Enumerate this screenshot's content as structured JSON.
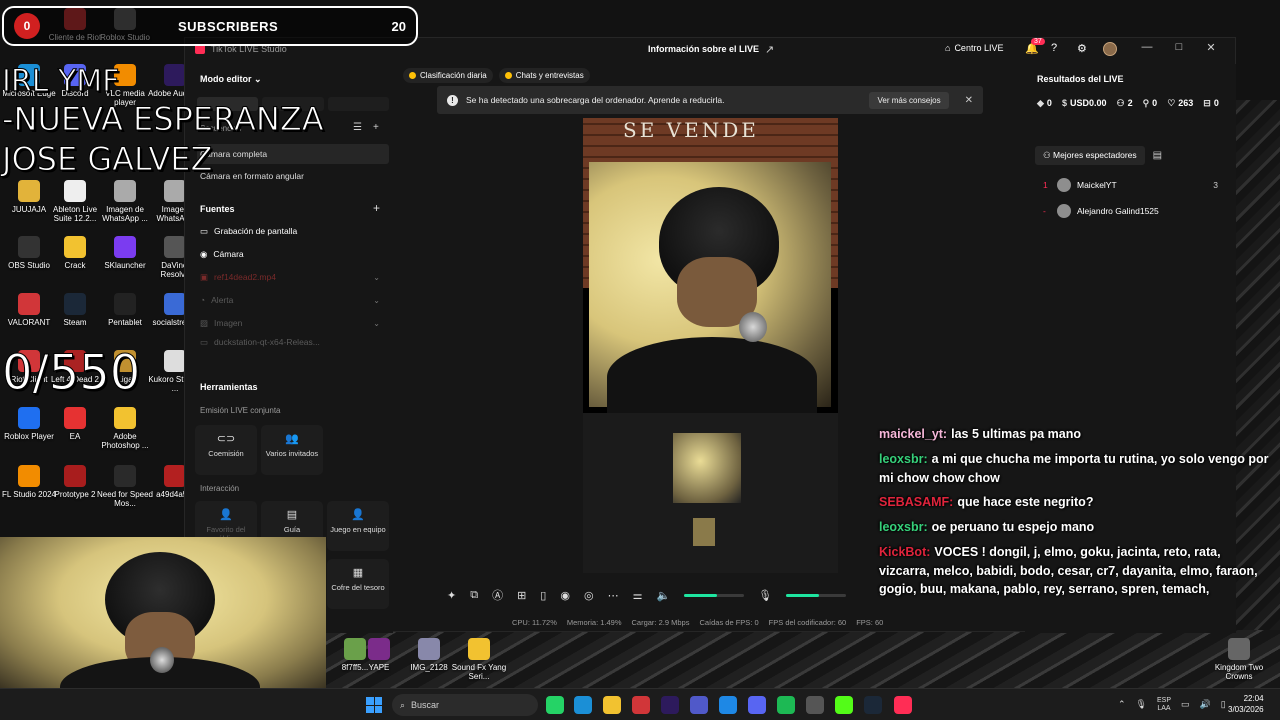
{
  "overlay": {
    "red_count": "0",
    "subscribers_label": "SUBSCRIBERS",
    "subscribers_count": "20",
    "line1": "IRL YMF",
    "line2": "-NUEVA ESPERANZA",
    "line3": "JOSE GALVEZ",
    "goal": "0/550"
  },
  "desktop_icons": [
    {
      "label": "Cliente de Riot",
      "color": "#d13639"
    },
    {
      "label": "Roblox Studio",
      "color": "#666"
    },
    {
      "label": "Microsoft Edge",
      "color": "#1b8fd6"
    },
    {
      "label": "Discord",
      "color": "#5865f2"
    },
    {
      "label": "VLC media player",
      "color": "#f28c00"
    },
    {
      "label": "Adobe Audition",
      "color": "#2d1a5c"
    },
    {
      "label": "JUUJAJA",
      "color": "#e2b33a"
    },
    {
      "label": "Ableton Live Suite 12.2...",
      "color": "#eee"
    },
    {
      "label": "Imagen de WhatsApp ...",
      "color": "#aaa"
    },
    {
      "label": "Imagen WhatsApp",
      "color": "#aaa"
    },
    {
      "label": "OBS Studio",
      "color": "#333"
    },
    {
      "label": "Crack",
      "color": "#f2c230"
    },
    {
      "label": "SKlauncher",
      "color": "#7b3cf0"
    },
    {
      "label": "DaVinci Resolve",
      "color": "#555"
    },
    {
      "label": "VALORANT",
      "color": "#d13639"
    },
    {
      "label": "Steam",
      "color": "#1b2838"
    },
    {
      "label": "Pentablet",
      "color": "#222"
    },
    {
      "label": "socialstream",
      "color": "#3a6ad6"
    },
    {
      "label": "Riot Client",
      "color": "#d13639"
    },
    {
      "label": "Left 4 Dead 2",
      "color": "#aa2222"
    },
    {
      "label": "Liga",
      "color": "#c09030"
    },
    {
      "label": "Kukoro Stream ...",
      "color": "#ddd"
    },
    {
      "label": "Roblox Player",
      "color": "#1f6ff0"
    },
    {
      "label": "EA",
      "color": "#e63232"
    },
    {
      "label": "Adobe Photoshop ...",
      "color": "#f2c230"
    },
    {
      "label": "FL Studio 2024",
      "color": "#f28c00"
    },
    {
      "label": "Prototype 2",
      "color": "#a81d1d"
    },
    {
      "label": "Need for Speed Mos...",
      "color": "#2a2a2a"
    },
    {
      "label": "a49d4a5...",
      "color": "#b32020"
    },
    {
      "label": "8f7ff5...",
      "color": "#6aa04a"
    },
    {
      "label": "YAPE",
      "color": "#7b2c8a"
    },
    {
      "label": "IMG_2128",
      "color": "#88a"
    },
    {
      "label": "Sound Fx Yang Seri...",
      "color": "#f2c230"
    },
    {
      "label": "Kingdom Two Crowns",
      "color": "#666"
    }
  ],
  "app": {
    "name": "TikTok LIVE Studio",
    "info_title": "Información sobre el LIVE",
    "home_label": "Centro LIVE",
    "notif_count": "37",
    "mode_label": "Modo editor",
    "sequences_label": "Secuencias",
    "scenes": [
      "Cámara completa",
      "Cámara en formato angular"
    ],
    "sources_label": "Fuentes",
    "sources": [
      "Grabación de pantalla",
      "Cámara",
      "ref14dead2.mp4",
      "Alerta",
      "Imagen",
      "duckstation-qt-x64-Releas..."
    ],
    "tools_label": "Herramientas",
    "joint_label": "Emisión LIVE conjunta",
    "tools_joint": [
      "Coemisión",
      "Varios invitados"
    ],
    "interaction_label": "Interacción",
    "tools_interaction": [
      "Favorito del público",
      "Guía",
      "Juego en equipo",
      "Cofre del tesoro"
    ],
    "pills": [
      "Clasificación diaria",
      "Chats y entrevistas"
    ],
    "alert_text": "Se ha detectado una sobrecarga del ordenador. Aprende a reducirla.",
    "alert_button": "Ver más consejos",
    "preview_sign": "SE VENDE",
    "stats": [
      "CPU: 11.72%",
      "Memoria: 1.49%",
      "Cargar: 2.9 Mbps",
      "Caídas de FPS: 0",
      "FPS del codificador: 60",
      "FPS: 60"
    ],
    "mic_level": 0.55,
    "right_title": "Resultados del LIVE",
    "metrics": [
      "0",
      "USD0.00",
      "2",
      "0",
      "263",
      "0"
    ],
    "top_viewers_tab": "Mejores espectadores",
    "viewers": [
      {
        "rank": "1",
        "name": "MaickelYT",
        "score": "3"
      },
      {
        "rank": "-",
        "name": "Alejandro Galind1525",
        "score": ""
      }
    ]
  },
  "chat": [
    {
      "user": "maickel_yt:",
      "text": "las 5 ultimas pa mano",
      "color": "#f5b6d8"
    },
    {
      "user": "leoxsbr:",
      "text": "a mi que chucha me importa tu rutina, yo solo vengo por mi chow chow chow",
      "color": "#36d07a"
    },
    {
      "user": "SEBASAMF:",
      "text": "que hace este negrito?",
      "color": "#e0243c"
    },
    {
      "user": "leoxsbr:",
      "text": "oe peruano tu espejo mano",
      "color": "#36d07a"
    },
    {
      "user": "KickBot:",
      "text": "VOCES ! dongil, j, elmo, goku, jacinta, reto, rata, vizcarra, melco, babidi, bodo, cesar, cr7, dayanita, elmo, faraon, gogio, buu, makana, pablo, rey, serrano, spren, temach,",
      "color": "#e0243c"
    }
  ],
  "taskbar": {
    "search_placeholder": "Buscar",
    "lang_top": "ESP",
    "lang_bottom": "LAA",
    "time": "22:04",
    "date": "3/03/2026"
  }
}
